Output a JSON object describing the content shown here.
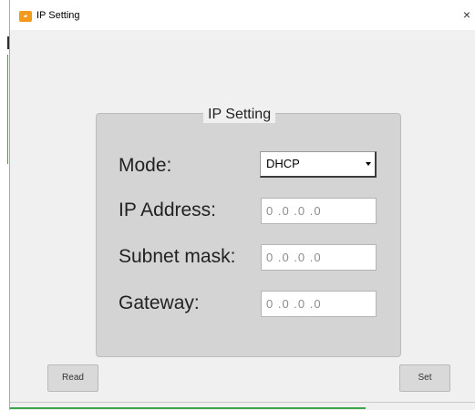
{
  "window": {
    "title": "IP Setting",
    "icon": "app-logo-icon",
    "close_glyph": "×"
  },
  "group": {
    "title": "IP Setting"
  },
  "form": {
    "mode_label": "Mode:",
    "mode_value": "DHCP",
    "ip_label": "IP Address:",
    "ip_value": "0 .0 .0 .0",
    "subnet_label": "Subnet mask:",
    "subnet_value": "0 .0 .0 .0",
    "gateway_label": "Gateway:",
    "gateway_value": "0 .0 .0 .0"
  },
  "buttons": {
    "read_label": "Read",
    "set_label": "Set"
  },
  "colors": {
    "window_bg": "#f0f0f0",
    "group_bg": "#d4d4d4",
    "icon_accent": "#f39a1e"
  }
}
